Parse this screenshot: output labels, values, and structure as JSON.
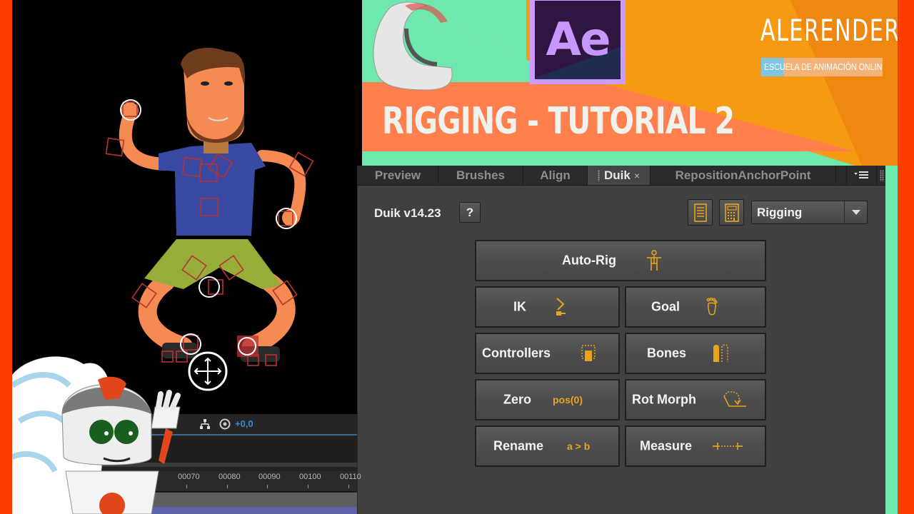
{
  "banner": {
    "app_logo": "Ae",
    "title": "RIGGING - TUTORIAL 2",
    "brand_name": "ALERENDER",
    "brand_tagline": "ESCUELA DE ANIMACIÓN ONLINE",
    "colors": {
      "mint": "#6ee8ad",
      "orange": "#f59a12",
      "coral": "#ff7f4d",
      "red_border": "#ff3c00",
      "ae_purple": "#cc9bff",
      "ae_bg": "#2f1640"
    }
  },
  "panel": {
    "tabs": [
      {
        "label": "Preview",
        "active": false
      },
      {
        "label": "Brushes",
        "active": false
      },
      {
        "label": "Align",
        "active": false
      },
      {
        "label": "Duik",
        "active": true,
        "closable": true,
        "close_glyph": "×"
      },
      {
        "label": "RepositionAnchorPoint",
        "active": false
      }
    ],
    "menu_icon": "panel-menu-icon",
    "version_label": "Duik v14.23",
    "help_label": "?",
    "toolbar_icons": [
      "notes-icon",
      "calculator-icon"
    ],
    "mode_select": {
      "selected": "Rigging"
    },
    "accent_color": "#e8a41c",
    "buttons": [
      {
        "id": "auto-rig",
        "label": "Auto-Rig",
        "icon": "person-icon"
      },
      {
        "id": "ik",
        "label": "IK",
        "icon": "ik-chain-icon"
      },
      {
        "id": "goal",
        "label": "Goal",
        "icon": "footprint-icon"
      },
      {
        "id": "controllers",
        "label": "Controllers",
        "icon": "controller-icon"
      },
      {
        "id": "bones",
        "label": "Bones",
        "icon": "bones-icon"
      },
      {
        "id": "zero",
        "label": "Zero",
        "icon_text": "pos(0)"
      },
      {
        "id": "rot-morph",
        "label": "Rot Morph",
        "icon": "rot-morph-icon"
      },
      {
        "id": "rename",
        "label": "Rename",
        "icon_text": "a > b"
      },
      {
        "id": "measure",
        "label": "Measure",
        "icon": "measure-icon"
      }
    ]
  },
  "timeline": {
    "offset_value": "+0,0",
    "ruler_ticks": [
      "00070",
      "00080",
      "00090",
      "00100",
      "00110"
    ]
  }
}
